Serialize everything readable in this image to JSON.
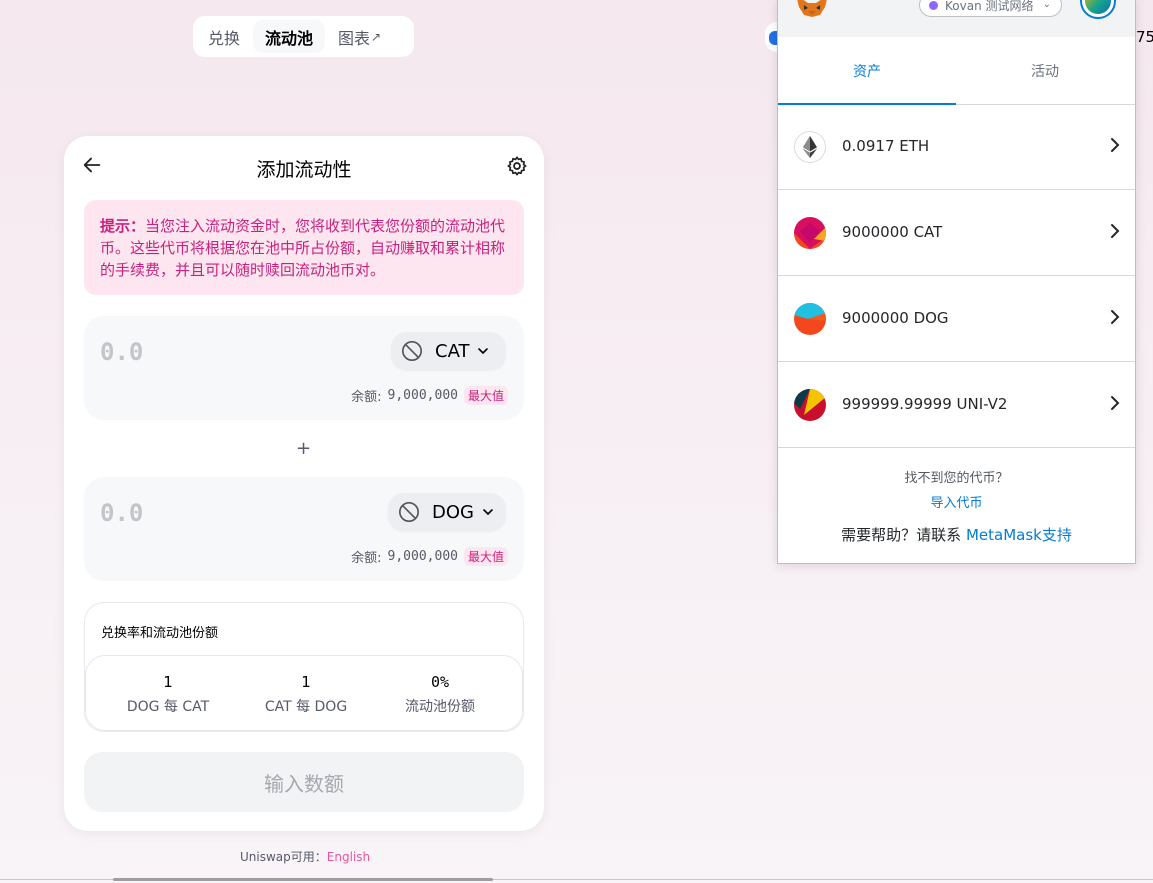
{
  "nav": {
    "tabs": [
      {
        "label": "兑换"
      },
      {
        "label": "流动池"
      },
      {
        "label": "图表",
        "ext": "↗"
      }
    ]
  },
  "top_right_partial_text": "75",
  "card": {
    "title": "添加流动性",
    "tip_label": "提示：",
    "tip_text": "当您注入流动资金时，您将收到代表您份额的流动池代币。这些代币将根据您在池中所占份额，自动赚取和累计相称的手续费，并且可以随时赎回流动池币对。",
    "input_a": {
      "placeholder": "0.0",
      "symbol": "CAT",
      "balance_label": "余额:",
      "balance": "9,000,000",
      "max_label": "最大值"
    },
    "plus": "+",
    "input_b": {
      "placeholder": "0.0",
      "symbol": "DOG",
      "balance_label": "余额:",
      "balance": "9,000,000",
      "max_label": "最大值"
    },
    "rates": {
      "title": "兑换率和流动池份额",
      "items": [
        {
          "value": "1",
          "label": "DOG 每 CAT"
        },
        {
          "value": "1",
          "label": "CAT 每 DOG"
        },
        {
          "value": "0%",
          "label": "流动池份额"
        }
      ]
    },
    "submit_label": "输入数额"
  },
  "footer": {
    "text": "Uniswap可用：",
    "link": "English"
  },
  "metamask": {
    "network_label": "Kovan 测试网络",
    "tabs": [
      {
        "label": "资产"
      },
      {
        "label": "活动"
      }
    ],
    "active_tab": "资产",
    "assets": [
      {
        "text": "0.0917 ETH",
        "icon": "eth-icon"
      },
      {
        "text": "9000000 CAT",
        "icon": "cat-token-icon"
      },
      {
        "text": "9000000 DOG",
        "icon": "dog-token-icon"
      },
      {
        "text": "999999.99999 UNI-V2",
        "icon": "uni-v2-token-icon"
      }
    ],
    "missing_token_text": "找不到您的代币？",
    "import_token_link": "导入代币",
    "help_text": "需要帮助？请联系",
    "help_link": "MetaMask支持"
  },
  "colors": {
    "accent_pink": "#c8227e",
    "tip_bg": "#fde6ef",
    "metamask_blue": "#037dd6",
    "network_dot": "#9064ff"
  }
}
